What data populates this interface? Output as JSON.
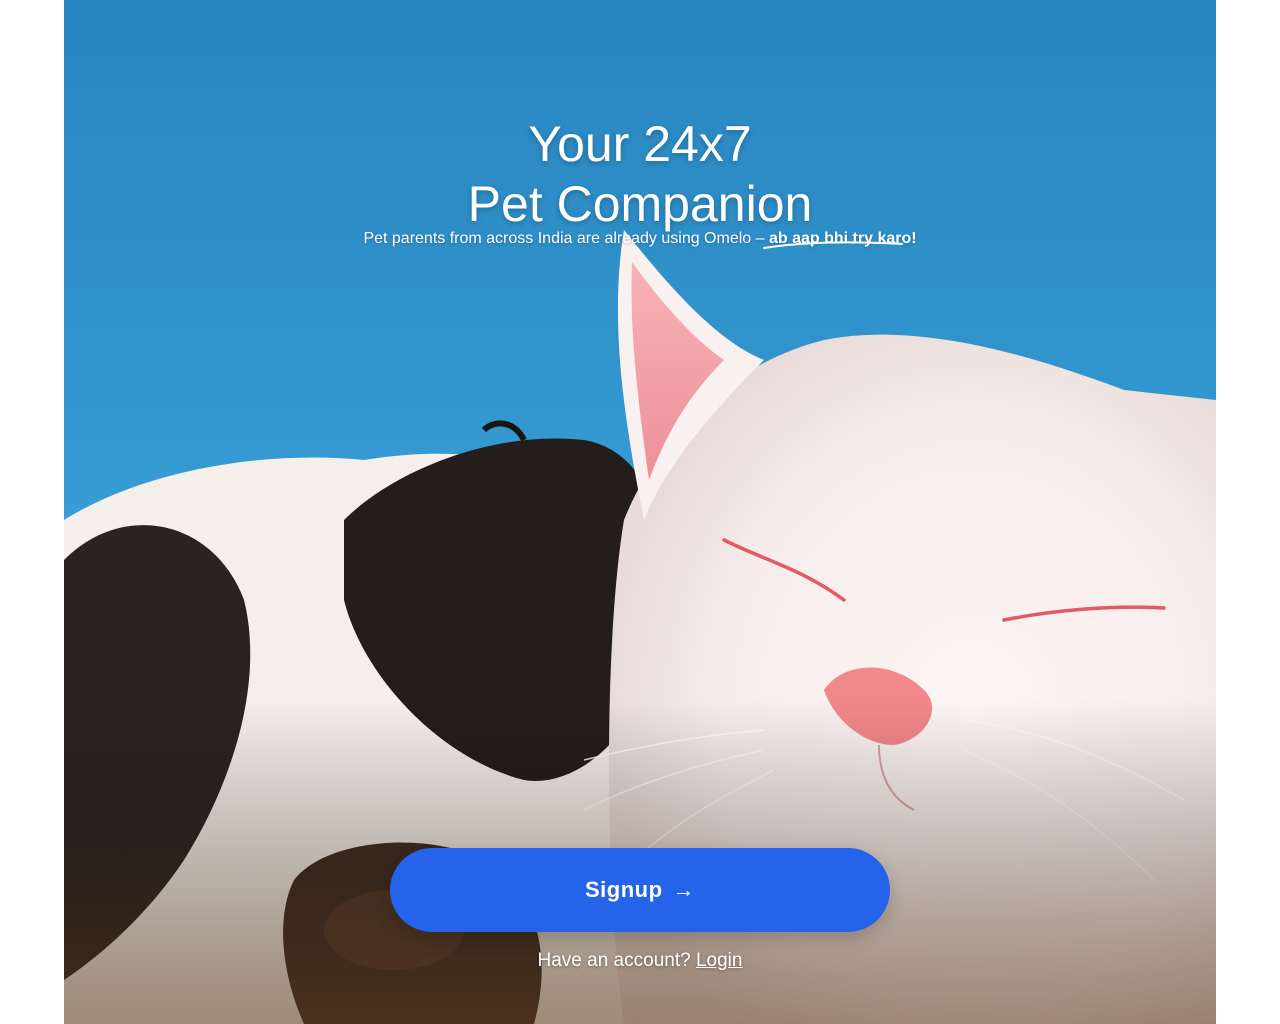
{
  "hero": {
    "title_line1": "Your 24x7",
    "title_line2": "Pet Companion",
    "subtitle_text": "Pet parents from across India are already using Omelo – ",
    "subtitle_emphasis": "ab aap bhi try karo!",
    "image_icon": "cat-and-dog-hero-image"
  },
  "cta": {
    "signup_label": "Signup",
    "signup_arrow": "→",
    "account_prompt": "Have an account?",
    "login_label": "Login"
  },
  "colors": {
    "primary_button": "#2563eb",
    "sky": "#3194cd",
    "text": "#ffffff"
  }
}
